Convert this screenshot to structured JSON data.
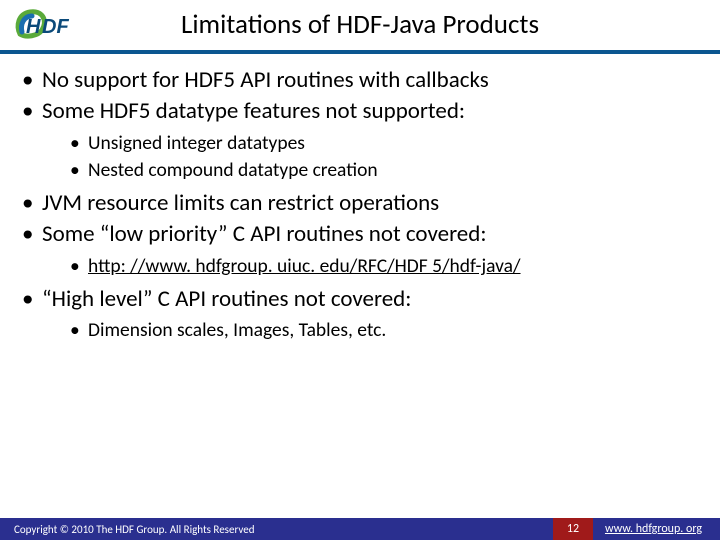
{
  "header": {
    "title": "Limitations of HDF-Java Products",
    "logo_text_h": "H",
    "logo_text_df": "DF"
  },
  "bullets": {
    "b1": "No support for HDF5 API routines with callbacks",
    "b2": "Some HDF5 datatype features not supported:",
    "b2_sub": {
      "s1": "Unsigned integer datatypes",
      "s2": "Nested compound datatype creation"
    },
    "b3": "JVM resource limits can restrict operations",
    "b4": "Some “low priority” C API routines not covered:",
    "b4_sub": {
      "s1": "http: //www. hdfgroup. uiuc. edu/RFC/HDF 5/hdf-java/"
    },
    "b5": "“High level” C API routines not covered:",
    "b5_sub": {
      "s1": "Dimension scales, Images, Tables, etc."
    }
  },
  "footer": {
    "copyright": "Copyright © 2010 The HDF Group.  All Rights Reserved",
    "page": "12",
    "url": "www. hdfgroup. org"
  }
}
